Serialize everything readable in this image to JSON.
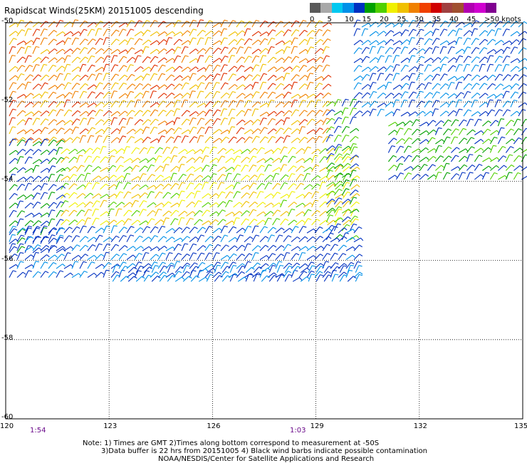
{
  "title": "Rapidscat Winds(25KM) 20151005 descending",
  "legend": {
    "labels": [
      "0",
      "5",
      "10",
      "15",
      "20",
      "25",
      "30",
      "35",
      "40",
      "45",
      ">50 knots"
    ],
    "colors": [
      "#5a5a5a",
      "#a8a8a8",
      "#00c8f0",
      "#0090e8",
      "#0030c0",
      "#00a000",
      "#50d000",
      "#f0f000",
      "#f0c000",
      "#f08000",
      "#f04000",
      "#d00000",
      "#a04040",
      "#a05030",
      "#b000b0",
      "#d000d0",
      "#800090"
    ]
  },
  "axes": {
    "lat_labels": [
      "-50",
      "-52",
      "-54",
      "-56",
      "-58",
      "-60"
    ],
    "lon_labels": [
      "120",
      "123",
      "126",
      "129",
      "132",
      "135"
    ]
  },
  "times": [
    "1:54",
    "1:03"
  ],
  "notes": {
    "line1": "Note: 1) Times are GMT 2)Times along bottom correspond to measurement at -50S",
    "line2": "3)Data buffer is 22 hrs from 20151005 4) Black wind barbs indicate possible contamination",
    "line3": "NOAA/NESDIS/Center for Satellite Applications and Research"
  },
  "map_data": {
    "type": "wind-barb-map",
    "lon_range": [
      120,
      135
    ],
    "lat_range": [
      -60,
      -50
    ],
    "speed_units": "knots",
    "regions": [
      {
        "lon": [
          120,
          129.3
        ],
        "lat": [
          -53.2,
          -50
        ],
        "speed": 28
      },
      {
        "lon": [
          121.5,
          130.2
        ],
        "lat": [
          -55.2,
          -53.2
        ],
        "speed": 23
      },
      {
        "lon": [
          120,
          121.5
        ],
        "lat": [
          -56,
          -53
        ],
        "speed": 14
      },
      {
        "lon": [
          129.2,
          130.2
        ],
        "lat": [
          -55.5,
          -52
        ],
        "speed": 17
      },
      {
        "lon": [
          120,
          130.2
        ],
        "lat": [
          -56.5,
          -55.2
        ],
        "speed": 11
      },
      {
        "lon": [
          123,
          130.2
        ],
        "lat": [
          -56.6,
          -56.2
        ],
        "speed": 9
      },
      {
        "lon": [
          130,
          135
        ],
        "lat": [
          -52.5,
          -50
        ],
        "speed": 10
      },
      {
        "lon": [
          131,
          135
        ],
        "lat": [
          -54,
          -52.5
        ],
        "speed": 16
      }
    ]
  }
}
